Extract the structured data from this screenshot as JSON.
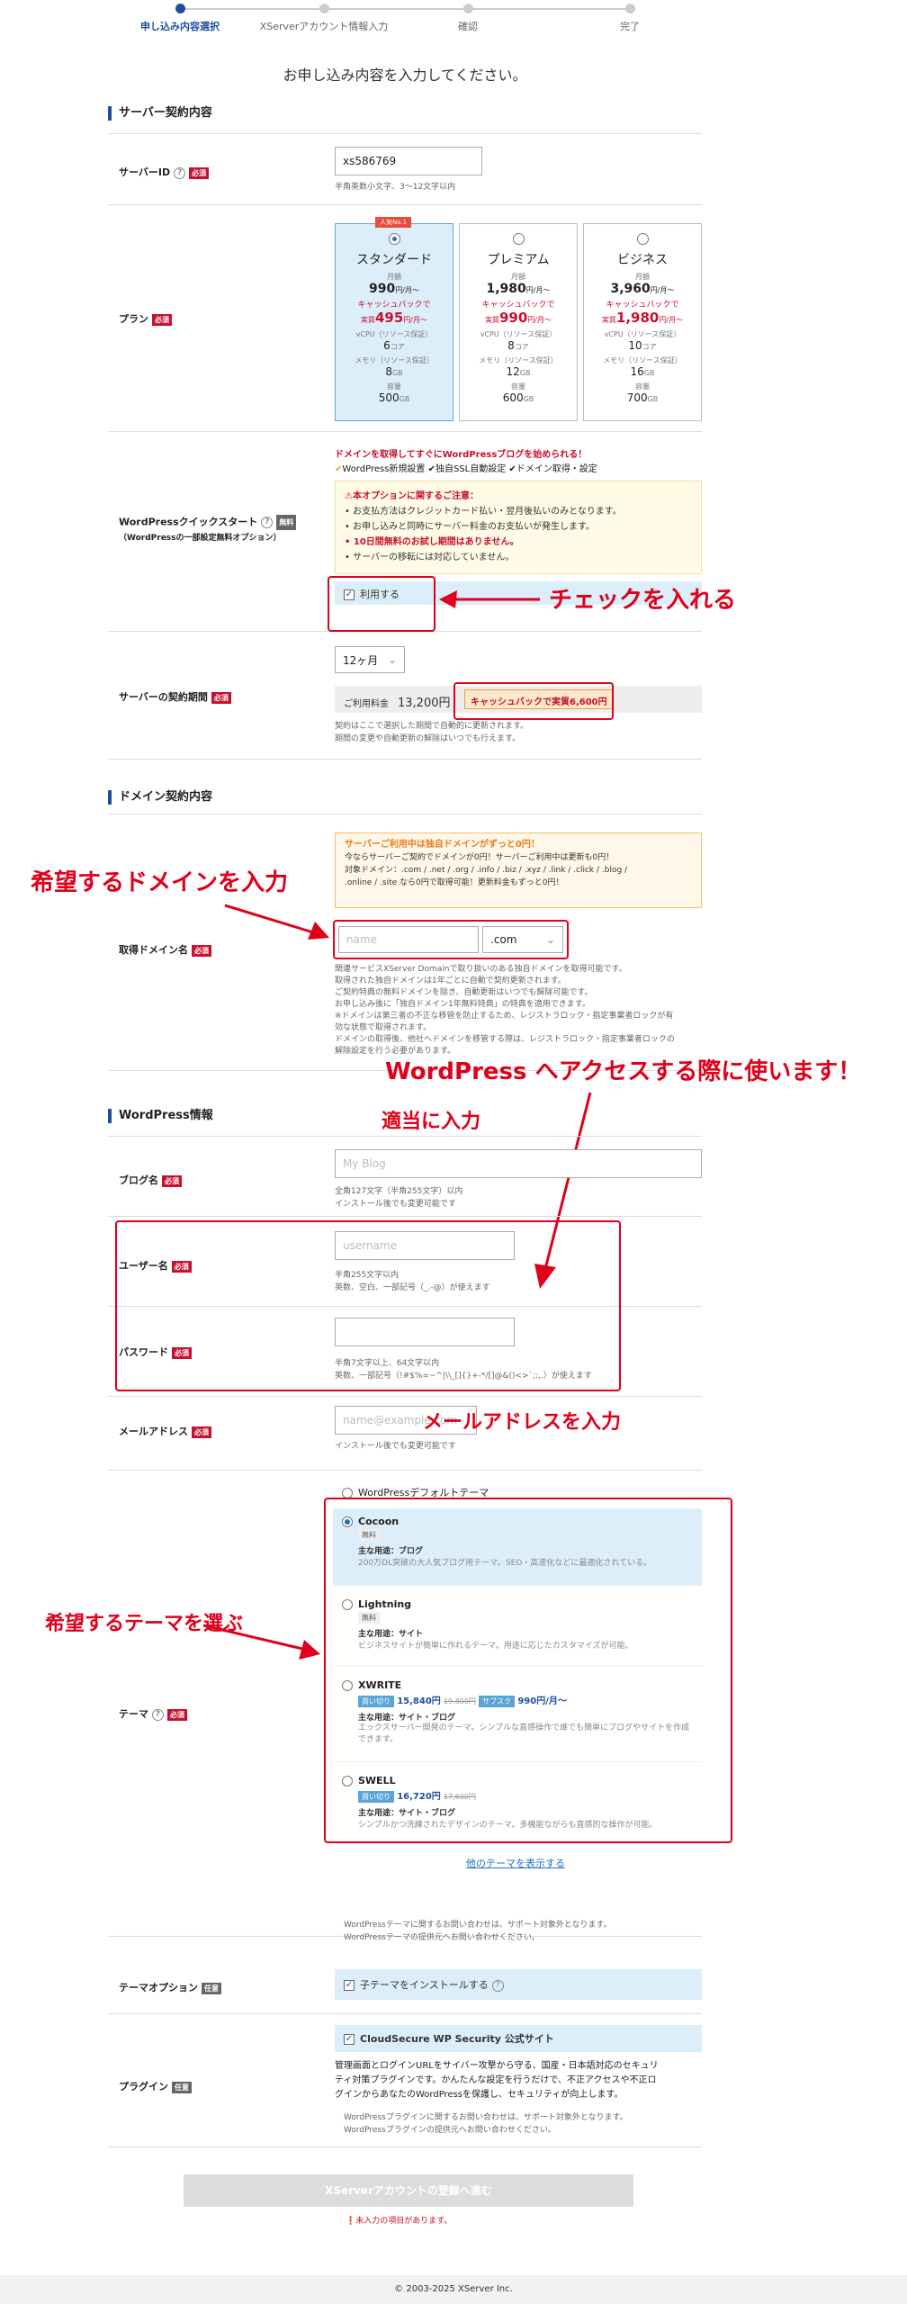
{
  "steps": [
    {
      "label": "申し込み内容選択"
    },
    {
      "label": "XServerアカウント情報入力"
    },
    {
      "label": "確認"
    },
    {
      "label": "完了"
    }
  ],
  "lead": "お申し込み内容を入力してください。",
  "sections": {
    "server": "サーバー契約内容",
    "domain": "ドメイン契約内容",
    "wordpress": "WordPress情報"
  },
  "badges": {
    "required": "必須",
    "optional": "任意",
    "free": "無料"
  },
  "server_id": {
    "label": "サーバーID",
    "value": "xs586769",
    "help": "半角英数小文字、3〜12文字以内"
  },
  "plan": {
    "label": "プラン",
    "recommended": "人気No.1",
    "items": [
      {
        "name": "スタンダード",
        "monthly": "月額",
        "price": "990",
        "unit": "円/月〜",
        "cb1": "キャッシュバックで",
        "cb_prefix": "実質",
        "cb_price": "495",
        "cb_unit": "円/月〜",
        "cpu_label": "vCPU（リソース保証）",
        "cpu": "6",
        "cpu_unit": "コア",
        "mem_label": "メモリ（リソース保証）",
        "mem": "8",
        "mem_unit": "GB",
        "disk_label": "容量",
        "disk": "500",
        "disk_unit": "GB"
      },
      {
        "name": "プレミアム",
        "monthly": "月額",
        "price": "1,980",
        "unit": "円/月〜",
        "cb1": "キャッシュバックで",
        "cb_prefix": "実質",
        "cb_price": "990",
        "cb_unit": "円/月〜",
        "cpu_label": "vCPU（リソース保証）",
        "cpu": "8",
        "cpu_unit": "コア",
        "mem_label": "メモリ（リソース保証）",
        "mem": "12",
        "mem_unit": "GB",
        "disk_label": "容量",
        "disk": "600",
        "disk_unit": "GB"
      },
      {
        "name": "ビジネス",
        "monthly": "月額",
        "price": "3,960",
        "unit": "円/月〜",
        "cb1": "キャッシュバックで",
        "cb_prefix": "実質",
        "cb_price": "1,980",
        "cb_unit": "円/月〜",
        "cpu_label": "vCPU（リソース保証）",
        "cpu": "10",
        "cpu_unit": "コア",
        "mem_label": "メモリ（リソース保証）",
        "mem": "16",
        "mem_unit": "GB",
        "disk_label": "容量",
        "disk": "700",
        "disk_unit": "GB"
      }
    ]
  },
  "wpquick": {
    "label": "WordPressクイックスタート",
    "sublabel": "（WordPressの一部設定無料オプション）",
    "promo": "ドメインを取得してすぐにWordPressブログを始められる！",
    "features": "WordPress新規設置 ✔独自SSL自動設定 ✔ドメイン取得・設定",
    "notice_title": "本オプションに関するご注意：",
    "notices": [
      "お支払方法はクレジットカード払い・翌月後払いのみとなります。",
      "お申し込みと同時にサーバー料金のお支払いが発生します。",
      "10日間無料のお試し期間はありません。",
      "サーバーの移転には対応していません。"
    ],
    "check_label": "利用する"
  },
  "term": {
    "label": "サーバーの契約期間",
    "value": "12ヶ月",
    "fee_label": "ご利用料金",
    "fee": "13,200円",
    "cashback": "キャッシュバックで実質6,600円",
    "help1": "契約はここで選択した期間で自動的に更新されます。",
    "help2": "期間の変更や自動更新の解除はいつでも行えます。"
  },
  "domain": {
    "promo_title": "サーバーご利用中は独自ドメインがずっと0円！",
    "promo_1": "今ならサーバーご契約でドメインが0円！サーバーご利用中は更新も0円！",
    "promo_2": "対象ドメイン：.com / .net / .org / .info / .biz / .xyz / .link / .click / .blog /",
    "promo_3": ".online / .site なら0円で取得可能！更新料金もずっと0円！",
    "label": "取得ドメイン名",
    "placeholder": "name",
    "tld": ".com",
    "help1": "関連サービスXServer Domainで取り扱いのある独自ドメインを取得可能です。",
    "help2": "取得された独自ドメインは1年ごとに自動で契約更新されます。",
    "help3": "ご契約特典の無料ドメインを除き、自動更新はいつでも解除可能です。",
    "help4": "お申し込み後に「独自ドメイン1年無料特典」の特典を適用できます。",
    "help5": "※ドメインは第三者の不正な移管を防止するため、レジストラロック・指定事業者ロックが有",
    "help6": "効な状態で取得されます。",
    "help7": "ドメインの取得後、他社へドメインを移管する際は、レジストラロック・指定事業者ロックの",
    "help8": "解除設定を行う必要があります。"
  },
  "blog": {
    "label": "ブログ名",
    "placeholder": "My Blog",
    "help1": "全角127文字（半角255文字）以内",
    "help2": "インストール後でも変更可能です"
  },
  "user": {
    "label": "ユーザー名",
    "placeholder": "username",
    "help1": "半角255文字以内",
    "help2": "英数、空白、一部記号（_.-@）が使えます"
  },
  "password": {
    "label": "パスワード",
    "help1": "半角7文字以上、64文字以内",
    "help2": "英数、一部記号（!#$%=~^|\\\\_[]{}+-*/[]@&()<>`;:,.）が使えます"
  },
  "email": {
    "label": "メールアドレス",
    "placeholder": "name@example.com",
    "help": "インストール後でも変更可能です"
  },
  "theme": {
    "label": "テーマ",
    "default": "WordPressデフォルトテーマ",
    "items": [
      {
        "name": "Cocoon",
        "tag": "無料",
        "use_label": "主な用途：ブログ",
        "desc": "200万DL突破の大人気ブログ用テーマ。SEO・高速化などに最適化されている。"
      },
      {
        "name": "Lightning",
        "tag": "無料",
        "use_label": "主な用途：サイト",
        "desc": "ビジネスサイトが簡単に作れるテーマ。用途に応じたカスタマイズが可能。"
      },
      {
        "name": "XWRITE",
        "tag": "買い切り",
        "price": "15,840円",
        "old": "19,800円",
        "sub_tag": "サブスク",
        "sub_price": "990円/月〜",
        "use_label": "主な用途：サイト・ブログ",
        "desc": "エックスサーバー開発のテーマ。シンプルな直感操作で誰でも簡単にブログやサイトを作成できます。"
      },
      {
        "name": "SWELL",
        "tag": "買い切り",
        "price": "16,720円",
        "old": "17,600円",
        "use_label": "主な用途：サイト・ブログ",
        "desc": "シンプルかつ洗練されたデザインのテーマ。多機能ながらも直感的な操作が可能。"
      }
    ],
    "more": "他のテーマを表示する",
    "note1": "WordPressテーマに関するお問い合わせは、サポート対象外となります。",
    "note2": "WordPressテーマの提供元へお問い合わせください。"
  },
  "theme_option": {
    "label": "テーマオプション",
    "check": "子テーマをインストールする"
  },
  "plugin": {
    "label": "プラグイン",
    "check": "CloudSecure WP Security 公式サイト",
    "desc1": "管理画面とログインURLをサイバー攻撃から守る、国産・日本語対応のセキュリ",
    "desc2": "ティ対策プラグインです。かんたんな設定を行うだけで、不正アクセスや不正ロ",
    "desc3": "グインからあなたのWordPressを保護し、セキュリティが向上します。",
    "note1": "WordPressプラグインに関するお問い合わせは、サポート対象外となります。",
    "note2": "WordPressプラグインの提供元へお問い合わせください。"
  },
  "submit": {
    "label": "XServerアカウントの登録へ進む",
    "error": "未入力の項目があります。"
  },
  "footer": "© 2003-2025 XServer Inc.",
  "annotations": {
    "check": "チェックを入れる",
    "domain": "希望するドメインを入力",
    "wp_access": "WordPress へアクセスする際に使います！",
    "blog": "適当に入力",
    "email": "メールアドレスを入力",
    "theme": "希望するテーマを選ぶ"
  },
  "colors": {
    "accent": "#1e4f9c",
    "required": "#c8102e",
    "annotation": "#e0001b"
  }
}
